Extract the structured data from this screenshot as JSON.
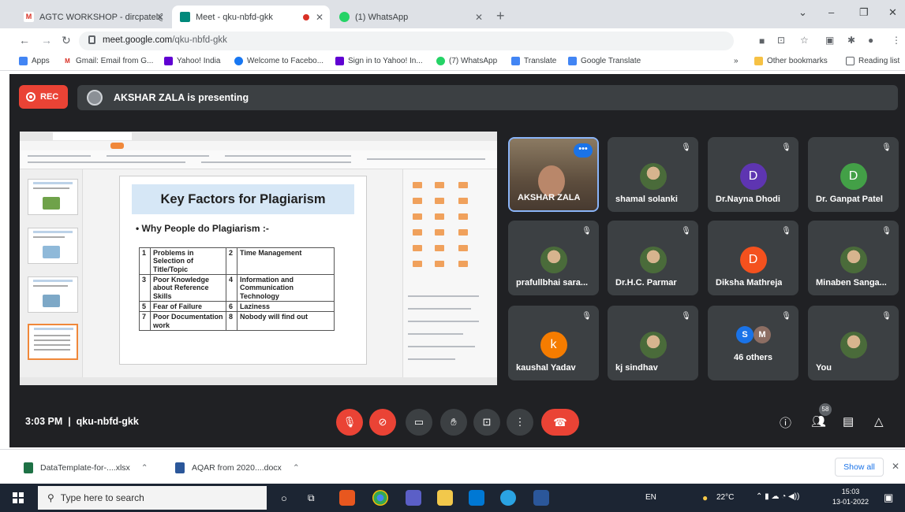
{
  "browser": {
    "tabs": [
      {
        "title": "AGTC WORKSHOP - dircpatel@",
        "favicon_letter": "M"
      },
      {
        "title": "Meet - qku-nbfd-gkk",
        "favicon_letter": ""
      },
      {
        "title": "(1) WhatsApp",
        "favicon_letter": ""
      }
    ],
    "url_domain": "meet.google.com",
    "url_path": "/qku-nbfd-gkk",
    "bookmarks": [
      {
        "label": "Apps"
      },
      {
        "label": "Gmail: Email from G..."
      },
      {
        "label": "Yahoo! India"
      },
      {
        "label": "Welcome to Facebo..."
      },
      {
        "label": "Sign in to Yahoo! In..."
      },
      {
        "label": "(7) WhatsApp"
      },
      {
        "label": "Translate"
      },
      {
        "label": "Google Translate"
      }
    ],
    "bookmarks_overflow": "»",
    "other_bookmarks": "Other bookmarks",
    "reading_list": "Reading list"
  },
  "meet": {
    "rec_label": "REC",
    "presenting_text": "AKSHAR ZALA is presenting",
    "slide": {
      "title": "Key Factors for Plagiarism",
      "subtitle": "•  Why People do Plagiarism :-",
      "rows": [
        {
          "n1": "1",
          "c1": "Problems in Selection of Title/Topic",
          "n2": "2",
          "c2": "Time Management"
        },
        {
          "n1": "3",
          "c1": "Poor Knowledge about Reference Skills",
          "n2": "4",
          "c2": "Information and Communication Technology"
        },
        {
          "n1": "5",
          "c1": "Fear of Failure",
          "n2": "6",
          "c2": "Laziness"
        },
        {
          "n1": "7",
          "c1": "Poor Documentation work",
          "n2": "8",
          "c2": "Nobody will find out"
        }
      ]
    },
    "participants": [
      {
        "name": "AKSHAR ZALA",
        "avatar": "video"
      },
      {
        "name": "shamal solanki",
        "avatar": "photo"
      },
      {
        "name": "Dr.Nayna Dhodi",
        "avatar": "D",
        "color": "#5e35b1"
      },
      {
        "name": "Dr. Ganpat Patel",
        "avatar": "D",
        "color": "#43a047"
      },
      {
        "name": "prafullbhai sara...",
        "avatar": "photo"
      },
      {
        "name": "Dr.H.C. Parmar",
        "avatar": "photo"
      },
      {
        "name": "Diksha Mathreja",
        "avatar": "D",
        "color": "#f4511e"
      },
      {
        "name": "Minaben Sanga...",
        "avatar": "photo"
      },
      {
        "name": "kaushal Yadav",
        "avatar": "k",
        "color": "#f57c00"
      },
      {
        "name": "kj sindhav",
        "avatar": "photo"
      },
      {
        "name": "46 others",
        "avatar": "group"
      },
      {
        "name": "You",
        "avatar": "photo"
      }
    ],
    "others_initials": [
      "S",
      "M"
    ],
    "time": "3:03 PM",
    "separator": "|",
    "meeting_code": "qku-nbfd-gkk",
    "people_count": "58"
  },
  "downloads": [
    {
      "name": "DataTemplate-for-....xlsx"
    },
    {
      "name": "AQAR from 2020....docx"
    }
  ],
  "show_all": "Show all",
  "taskbar": {
    "search_placeholder": "Type here to search",
    "lang": "EN",
    "temperature": "22°C",
    "clock_time": "15:03",
    "clock_date": "13-01-2022"
  }
}
